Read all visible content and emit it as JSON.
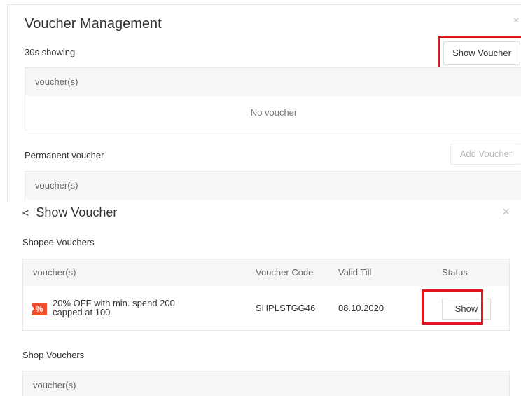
{
  "voucher_management": {
    "title": "Voucher Management",
    "close_glyph": "×",
    "showing_label": "30s showing",
    "show_voucher_button": "Show Voucher",
    "list_header": "voucher(s)",
    "empty_text": "No voucher",
    "permanent_label": "Permanent voucher",
    "add_voucher_button": "Add Voucher",
    "permanent_list_header": "voucher(s)"
  },
  "show_voucher": {
    "back_glyph": "<",
    "title": "Show Voucher",
    "close_glyph": "×",
    "shopee_section": "Shopee Vouchers",
    "columns": {
      "voucher": "voucher(s)",
      "code": "Voucher Code",
      "valid": "Valid Till",
      "status": "Status"
    },
    "rows": [
      {
        "icon": "percent-tag-icon",
        "icon_glyph": "%",
        "line1": "20% OFF with min. spend 200",
        "line2": "capped at 100",
        "code": "SHPLSTGG46",
        "valid_till": "08.10.2020",
        "action": "Show"
      }
    ],
    "shop_section": "Shop Vouchers",
    "shop_list_header": "voucher(s)"
  },
  "colors": {
    "highlight": "#e0141e",
    "brand": "#ee4d2d",
    "header_bg": "#f6f6f6"
  }
}
